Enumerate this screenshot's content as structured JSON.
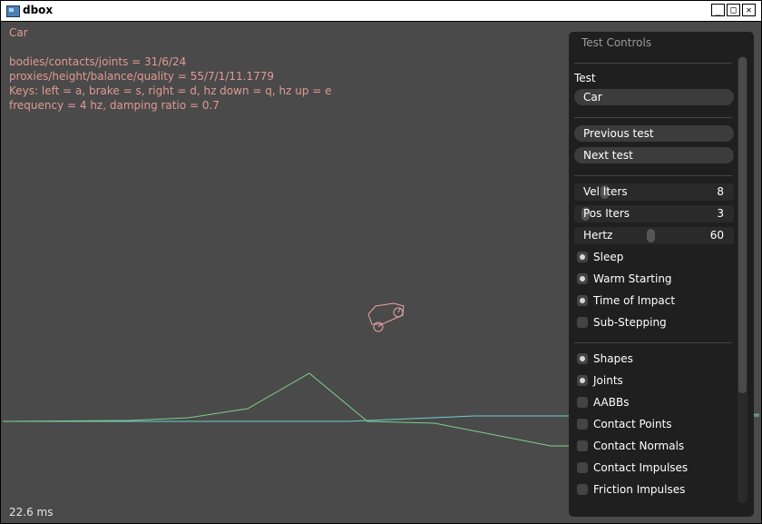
{
  "window": {
    "title": "dbox",
    "min_glyph": "_",
    "max_glyph": "□",
    "close_glyph": "✕"
  },
  "overlay": {
    "test_name": "Car",
    "stats_line": "bodies/contacts/joints = 31/6/24",
    "proxies_line": "proxies/height/balance/quality = 55/7/1/11.1779",
    "keys_line": "Keys: left = a, brake = s, right = d, hz down = q, hz up = e",
    "freq_line": "frequency = 4 hz, damping ratio = 0.7",
    "frame_time": "22.6 ms"
  },
  "panel": {
    "title": "Test Controls",
    "test_label": "Test",
    "test_selected": "Car",
    "prev_button": "Previous test",
    "next_button": "Next test",
    "sliders": [
      {
        "label": "Vel Iters",
        "value": "8",
        "fraction": 0.14
      },
      {
        "label": "Pos Iters",
        "value": "3",
        "fraction": 0.0
      },
      {
        "label": "Hertz",
        "value": "60",
        "fraction": 0.48
      }
    ],
    "checkboxes_sim": [
      {
        "label": "Sleep",
        "checked": true
      },
      {
        "label": "Warm Starting",
        "checked": true
      },
      {
        "label": "Time of Impact",
        "checked": true
      },
      {
        "label": "Sub-Stepping",
        "checked": false
      }
    ],
    "checkboxes_draw": [
      {
        "label": "Shapes",
        "checked": true
      },
      {
        "label": "Joints",
        "checked": true
      },
      {
        "label": "AABBs",
        "checked": false
      },
      {
        "label": "Contact Points",
        "checked": false
      },
      {
        "label": "Contact Normals",
        "checked": false
      },
      {
        "label": "Contact Impulses",
        "checked": false
      },
      {
        "label": "Friction Impulses",
        "checked": false
      }
    ]
  },
  "colors": {
    "background": "#4a4a4a",
    "overlay_text": "#e09a92",
    "ground_line": "#7fcf8a",
    "cyan_line": "#6fd0d0",
    "car": "#e6a5a5"
  }
}
